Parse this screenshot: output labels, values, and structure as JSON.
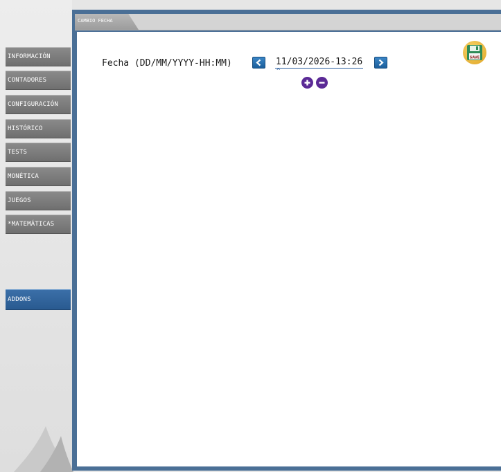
{
  "sidebar": {
    "items": [
      {
        "label": "INFORMACIÓN"
      },
      {
        "label": "CONTADORES"
      },
      {
        "label": "CONFIGURACIÓN"
      },
      {
        "label": "HISTÓRICO"
      },
      {
        "label": "TESTS"
      },
      {
        "label": "MONÉTICA"
      },
      {
        "label": "JUEGOS"
      },
      {
        "label": "*MATEMÁTICAS"
      },
      {
        "label": "ADDONS",
        "active": true
      }
    ]
  },
  "tabs": [
    {
      "label": "CAMBIO FECHA",
      "active": true
    }
  ],
  "date_form": {
    "label": "Fecha (DD/MM/YYYY-HH:MM)",
    "value": "11/03/2026-13:26",
    "caret": "^",
    "increment_icon": "plus-circle-icon",
    "decrement_icon": "minus-circle-icon",
    "prev_icon": "chevron-left-icon",
    "next_icon": "chevron-right-icon"
  },
  "save_button": {
    "label": "SAVE",
    "icon": "floppy-disk-icon"
  },
  "colors": {
    "nav_bg": "#7d7d7d",
    "nav_active": "#3465a0",
    "frame": "#4a6f96",
    "arrow_btn": "#2a74b4",
    "round_btn": "#5b2a96",
    "save_btn": "#e9b634"
  }
}
